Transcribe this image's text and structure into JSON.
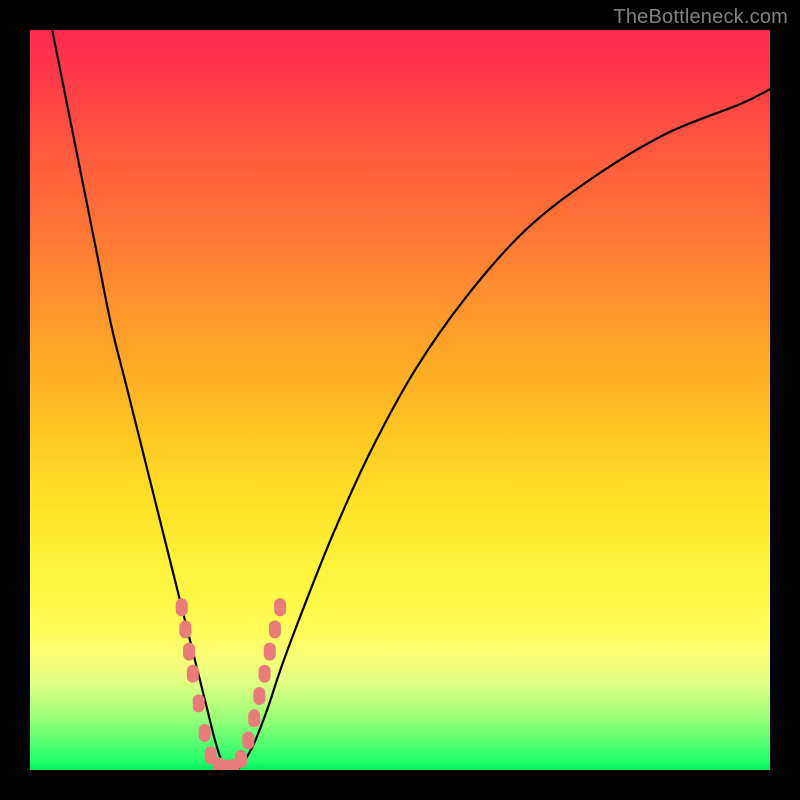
{
  "watermark": "TheBottleneck.com",
  "chart_data": {
    "type": "line",
    "title": "",
    "xlabel": "",
    "ylabel": "",
    "xlim": [
      0,
      100
    ],
    "ylim": [
      0,
      100
    ],
    "series": [
      {
        "name": "bottleneck-curve",
        "x": [
          3,
          5,
          7,
          9,
          11,
          13,
          15,
          17,
          19,
          21,
          22,
          23,
          24,
          25,
          26,
          27,
          28,
          30,
          32,
          34,
          37,
          41,
          46,
          52,
          59,
          67,
          76,
          86,
          96,
          100
        ],
        "y": [
          100,
          90,
          80,
          70,
          60,
          52,
          44,
          36,
          28,
          20,
          16,
          12,
          8,
          4,
          1,
          0,
          0,
          3,
          8,
          14,
          22,
          32,
          43,
          54,
          64,
          73,
          80,
          86,
          90,
          92
        ]
      }
    ],
    "markers": {
      "name": "highlight-dots",
      "color": "#e77c78",
      "points": [
        {
          "x": 20.5,
          "y": 22
        },
        {
          "x": 21.0,
          "y": 19
        },
        {
          "x": 21.5,
          "y": 16
        },
        {
          "x": 22.0,
          "y": 13
        },
        {
          "x": 22.8,
          "y": 9
        },
        {
          "x": 23.6,
          "y": 5
        },
        {
          "x": 24.4,
          "y": 2
        },
        {
          "x": 25.5,
          "y": 0.5
        },
        {
          "x": 26.5,
          "y": 0.2
        },
        {
          "x": 27.5,
          "y": 0.3
        },
        {
          "x": 28.5,
          "y": 1.5
        },
        {
          "x": 29.5,
          "y": 4
        },
        {
          "x": 30.3,
          "y": 7
        },
        {
          "x": 31.0,
          "y": 10
        },
        {
          "x": 31.7,
          "y": 13
        },
        {
          "x": 32.4,
          "y": 16
        },
        {
          "x": 33.1,
          "y": 19
        },
        {
          "x": 33.8,
          "y": 22
        }
      ]
    },
    "grid": false,
    "legend": false
  }
}
